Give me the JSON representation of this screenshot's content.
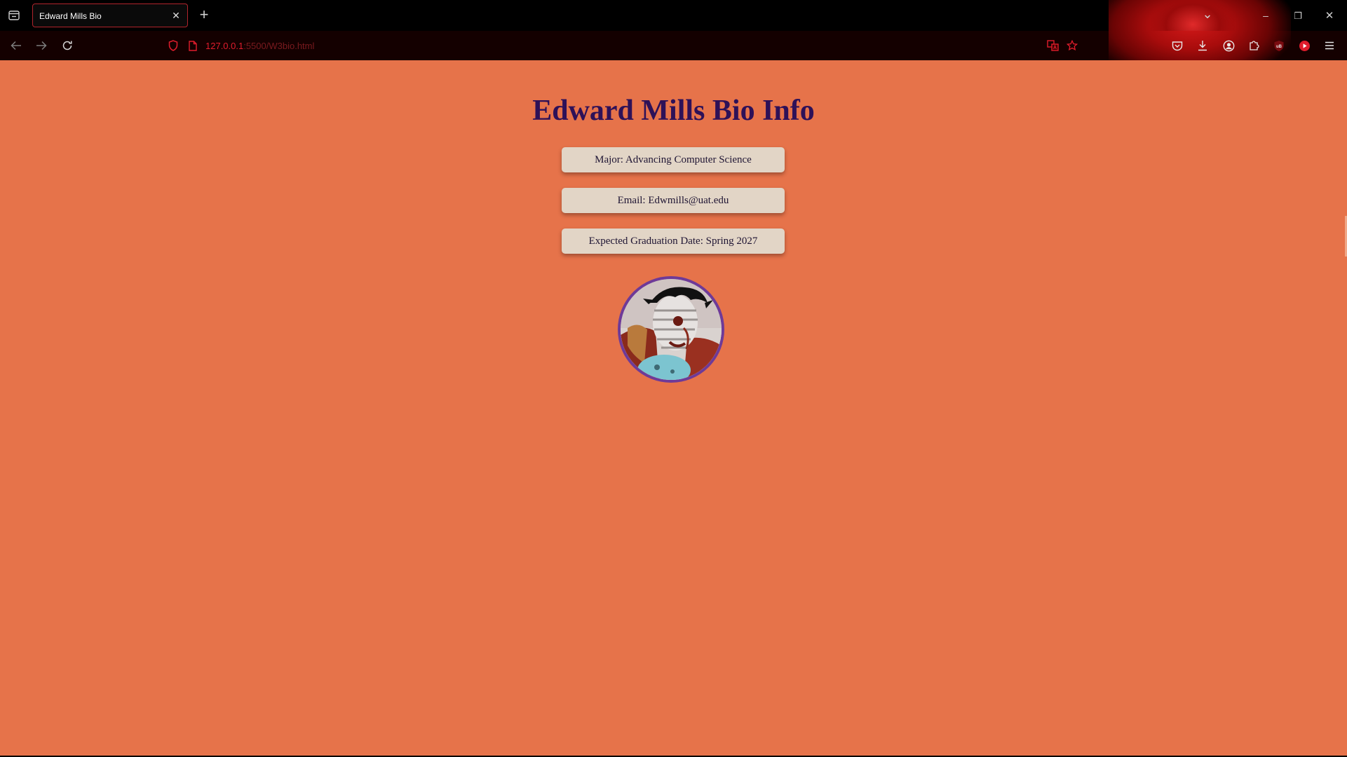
{
  "browser": {
    "tab": {
      "title": "Edward Mills Bio",
      "close_glyph": "✕"
    },
    "new_tab_glyph": "+",
    "url": {
      "host": "127.0.0.1",
      "path": ":5500/W3bio.html"
    },
    "window_controls": {
      "list_tabs": "⌄",
      "minimize": "–",
      "restore": "❐",
      "close": "✕"
    },
    "icons": [
      "tab-overview-icon",
      "back-icon",
      "forward-icon",
      "reload-icon",
      "shield-icon",
      "page-icon",
      "translate-icon",
      "bookmark-star-icon",
      "pocket-icon",
      "download-icon",
      "account-icon",
      "extensions-icon",
      "ublock-icon",
      "youtube-icon",
      "menu-icon"
    ],
    "ublock_label": "uB",
    "theme_accent": "#e01c2c"
  },
  "page": {
    "title": "Edward Mills Bio Info",
    "background": "#e6734a",
    "title_color": "#2e1158",
    "info": [
      {
        "text": "Major: Advancing Computer Science"
      },
      {
        "text": "Email: Edwmills@uat.edu"
      },
      {
        "text": "Expected Graduation Date: Spring 2027"
      }
    ],
    "avatar_border_color": "#6e3a98"
  }
}
